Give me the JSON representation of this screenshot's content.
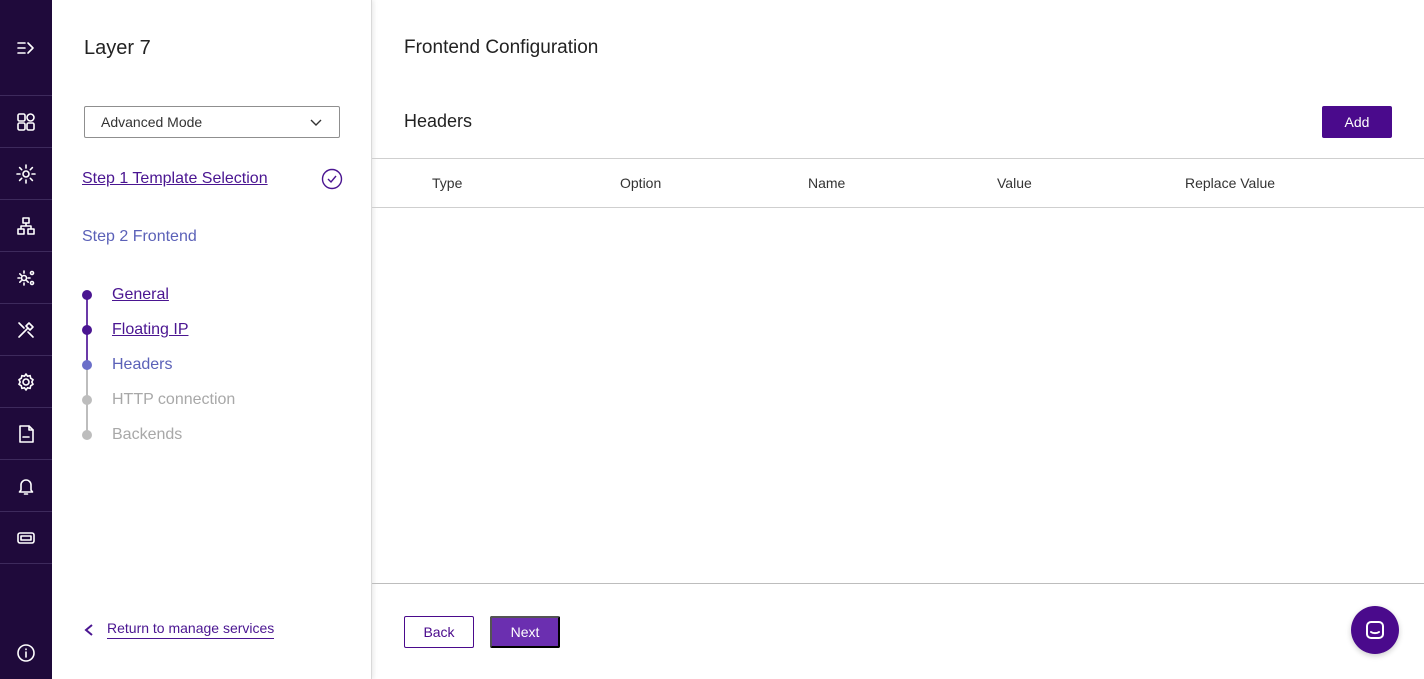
{
  "rail": {
    "icons": [
      "expand-menu-icon",
      "dashboard-icon",
      "services-gear-icon",
      "network-icon",
      "settings-advanced-icon",
      "tools-icon",
      "settings-icon",
      "log-file-icon",
      "bell-icon",
      "ticket-icon",
      "info-icon"
    ]
  },
  "wizard": {
    "title": "Layer 7",
    "mode": "Advanced Mode",
    "step1": "Step 1 Template Selection",
    "step2": "Step 2 Frontend",
    "substeps": [
      {
        "label": "General",
        "state": "done"
      },
      {
        "label": "Floating IP",
        "state": "done"
      },
      {
        "label": "Headers",
        "state": "current"
      },
      {
        "label": "HTTP connection",
        "state": "todo"
      },
      {
        "label": "Backends",
        "state": "todo"
      }
    ],
    "return_label": "Return to manage services"
  },
  "main": {
    "page_title": "Frontend Configuration",
    "section_title": "Headers",
    "add_label": "Add",
    "columns": [
      "Type",
      "Option",
      "Name",
      "Value",
      "Replace Value"
    ],
    "back_label": "Back",
    "next_label": "Next"
  },
  "colors": {
    "rail_bg": "#1f0a3b",
    "primary": "#4a0a8c",
    "link": "#4a1591",
    "current_step": "#5b61b8",
    "todo_step": "#a8a8a8"
  }
}
